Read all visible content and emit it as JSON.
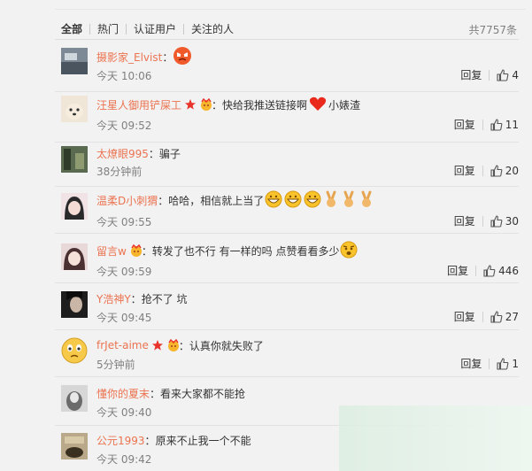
{
  "tabs": [
    {
      "label": "全部"
    },
    {
      "label": "热门"
    },
    {
      "label": "认证用户"
    },
    {
      "label": "关注的人"
    }
  ],
  "total": "共7757条",
  "reply_label": "回复",
  "comments": [
    {
      "user": "摄影家_Elvist",
      "colon": "：",
      "text": "",
      "time": "今天 10:06",
      "likes": "4"
    },
    {
      "user": "汪星人御用铲屎工",
      "colon": "：",
      "text": "快给我推送链接啊",
      "text2": "小婊渣",
      "time": "今天 09:52",
      "likes": "11"
    },
    {
      "user": "太燎眼995",
      "colon": "：",
      "text": "骗子",
      "time": "38分钟前",
      "likes": "20"
    },
    {
      "user": "温柔D小刺猬",
      "colon": "：",
      "text": "哈哈，相信就上当了",
      "time": "今天 09:55",
      "likes": "30"
    },
    {
      "user": "留言w",
      "colon": "：",
      "text": "转发了也不行 有一样的吗 点赞看看多少",
      "time": "今天 09:59",
      "likes": "446"
    },
    {
      "user": "Y浩神Y",
      "colon": "：",
      "text": "抢不了 坑",
      "time": "今天 09:45",
      "likes": "27"
    },
    {
      "user": "frJet-aime",
      "colon": "：",
      "text": "认真你就失败了",
      "time": "5分钟前",
      "likes": "1"
    },
    {
      "user": "懂你的夏末",
      "colon": "：",
      "text": "看来大家都不能抢",
      "time": "今天 09:40",
      "likes": ""
    },
    {
      "user": "公元1993",
      "colon": "：",
      "text": "原来不止我一个不能",
      "time": "今天 09:42",
      "likes": ""
    }
  ],
  "colors": {
    "username": "#eb7350",
    "muted": "#808080"
  }
}
